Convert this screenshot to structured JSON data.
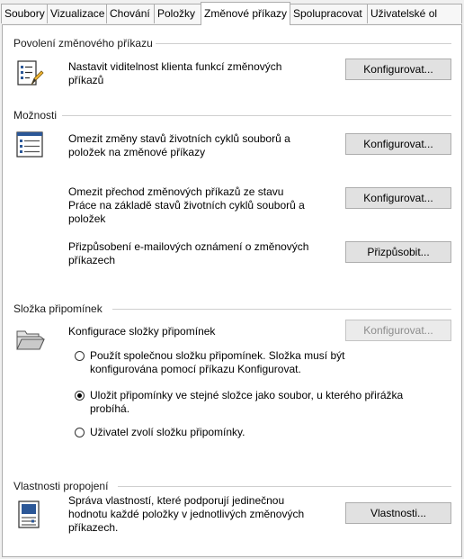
{
  "tabs": [
    {
      "label": "Soubory"
    },
    {
      "label": "Vizualizace"
    },
    {
      "label": "Chování"
    },
    {
      "label": "Položky"
    },
    {
      "label": "Změnové příkazy"
    },
    {
      "label": "Spolupracovat"
    },
    {
      "label": "Uživatelské ol"
    }
  ],
  "active_tab": "Změnové příkazy",
  "sections": {
    "povoleni": {
      "title": "Povolení změnového příkazu",
      "desc": "Nastavit viditelnost klienta funkcí změnových příkazů",
      "button": "Konfigurovat...",
      "icon": "checklist-pencil-icon"
    },
    "moznosti": {
      "title": "Možnosti",
      "icon": "list-form-icon",
      "items": [
        {
          "desc": "Omezit změny stavů životních cyklů souborů a položek na změnové příkazy",
          "button": "Konfigurovat..."
        },
        {
          "desc": "Omezit přechod změnových příkazů ze stavu Práce na základě stavů životních cyklů souborů a položek",
          "button": "Konfigurovat..."
        },
        {
          "desc": "Přizpůsobení e-mailových oznámení o změnových příkazech",
          "button": "Přizpůsobit..."
        }
      ]
    },
    "slozka": {
      "title": "Složka připomínek",
      "desc": "Konfigurace složky připomínek",
      "button": "Konfigurovat...",
      "button_disabled": true,
      "icon": "folder-open-icon",
      "options": [
        {
          "label": "Použít společnou složku připomínek. Složka musí být konfigurována pomocí příkazu Konfigurovat.",
          "checked": false
        },
        {
          "label": "Uložit připomínky ve stejné složce jako soubor, u kterého přirážka probíhá.",
          "checked": true
        },
        {
          "label": "Uživatel zvolí složku připomínky.",
          "checked": false
        }
      ]
    },
    "vlastnosti": {
      "title": "Vlastnosti propojení",
      "desc": "Správa vlastností, které podporují jedinečnou hodnotu každé položky v jednotlivých změnových příkazech.",
      "button": "Vlastnosti...",
      "icon": "properties-panel-icon"
    }
  },
  "colors": {
    "panel_bg": "#ffffff",
    "window_bg": "#f0f0f0",
    "button_bg": "#e1e1e1",
    "border": "#adadad",
    "icon_blue": "#2b5797"
  }
}
